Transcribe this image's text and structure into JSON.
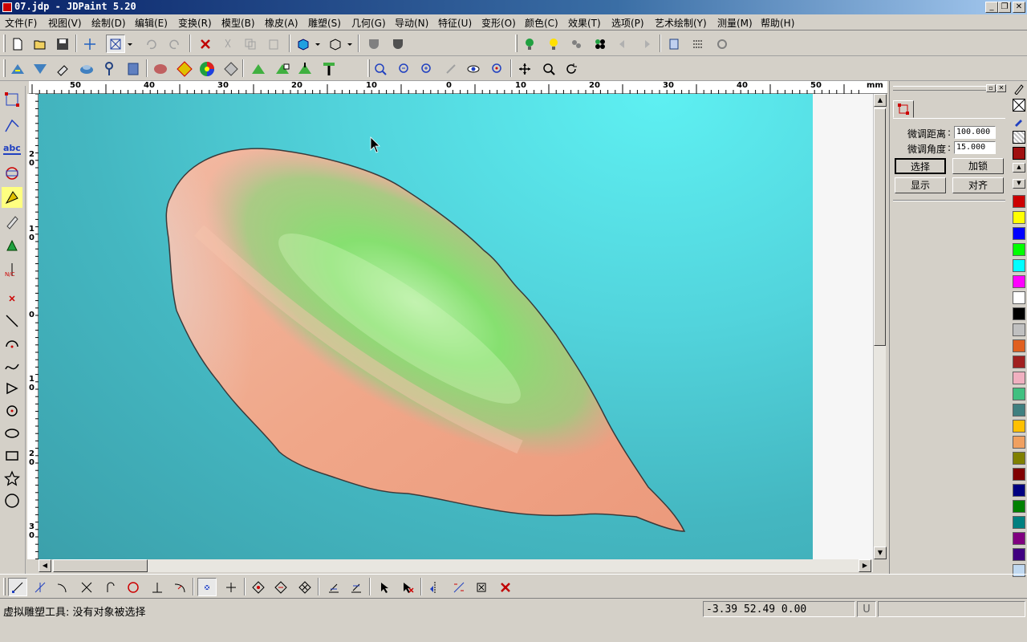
{
  "window": {
    "title": "07.jdp - JDPaint 5.20"
  },
  "menu": [
    "文件(F)",
    "视图(V)",
    "绘制(D)",
    "编辑(E)",
    "变换(R)",
    "模型(B)",
    "橡皮(A)",
    "雕塑(S)",
    "几何(G)",
    "导动(N)",
    "特征(U)",
    "变形(O)",
    "颜色(C)",
    "效果(T)",
    "选项(P)",
    "艺术绘制(Y)",
    "测量(M)",
    "帮助(H)"
  ],
  "ruler": {
    "unit": "mm",
    "h_labels": [
      "50",
      "40",
      "30",
      "20",
      "10",
      "0",
      "10",
      "20",
      "30",
      "40",
      "50"
    ],
    "v_labels": [
      "2\n0",
      "1\n0",
      "0",
      "1\n0",
      "2\n0",
      "3\n0"
    ]
  },
  "panel": {
    "tab_icon": "select-node-icon",
    "distance_label": "微调距离",
    "distance_value": "100.000",
    "angle_label": "微调角度",
    "angle_value": "15.000",
    "buttons": {
      "select": "选择",
      "lock": "加锁",
      "show": "显示",
      "align": "对齐"
    }
  },
  "palette": {
    "colors": [
      "#cc0000",
      "#ffff00",
      "#0000ff",
      "#00ff00",
      "#00ffff",
      "#ff00ff",
      "#ffffff",
      "#000000",
      "#c0c0c0",
      "#e06020",
      "#a02020",
      "#f0b0c0",
      "#40c080",
      "#408080",
      "#ffc000",
      "#f0a060",
      "#808000",
      "#800000",
      "#000080",
      "#008000",
      "#008080",
      "#800080",
      "#400080",
      "#c0d8f0"
    ]
  },
  "status": {
    "message": "虚拟雕塑工具: 没有对象被选择",
    "coords": "-3.39 52.49 0.00",
    "mode": "U"
  }
}
